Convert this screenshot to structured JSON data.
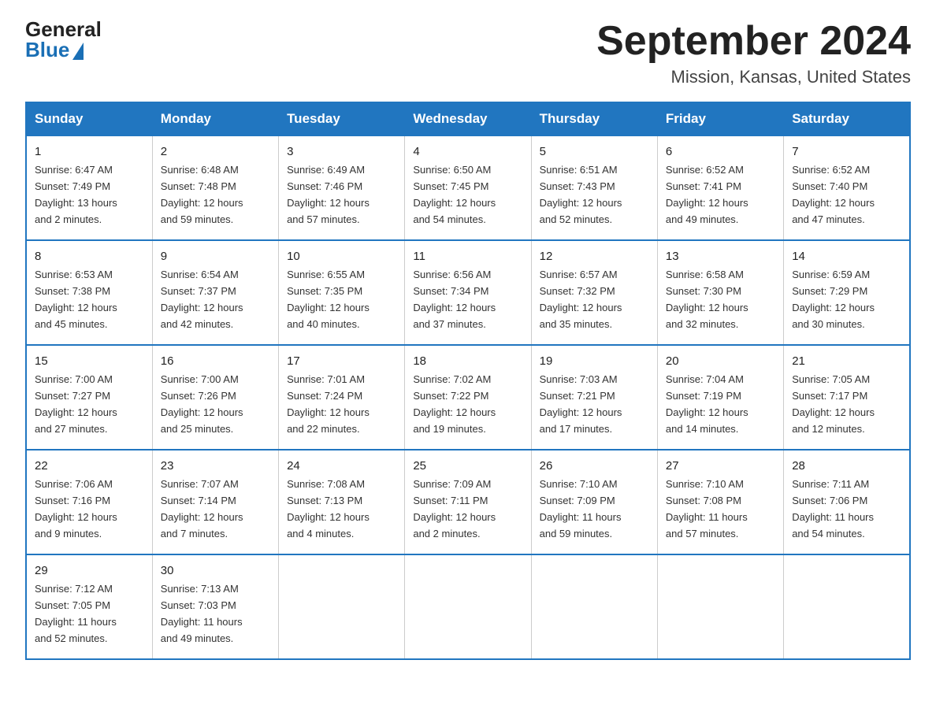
{
  "logo": {
    "general": "General",
    "blue": "Blue"
  },
  "title": "September 2024",
  "location": "Mission, Kansas, United States",
  "days_of_week": [
    "Sunday",
    "Monday",
    "Tuesday",
    "Wednesday",
    "Thursday",
    "Friday",
    "Saturday"
  ],
  "weeks": [
    [
      {
        "num": "1",
        "sunrise": "6:47 AM",
        "sunset": "7:49 PM",
        "daylight": "13 hours and 2 minutes."
      },
      {
        "num": "2",
        "sunrise": "6:48 AM",
        "sunset": "7:48 PM",
        "daylight": "12 hours and 59 minutes."
      },
      {
        "num": "3",
        "sunrise": "6:49 AM",
        "sunset": "7:46 PM",
        "daylight": "12 hours and 57 minutes."
      },
      {
        "num": "4",
        "sunrise": "6:50 AM",
        "sunset": "7:45 PM",
        "daylight": "12 hours and 54 minutes."
      },
      {
        "num": "5",
        "sunrise": "6:51 AM",
        "sunset": "7:43 PM",
        "daylight": "12 hours and 52 minutes."
      },
      {
        "num": "6",
        "sunrise": "6:52 AM",
        "sunset": "7:41 PM",
        "daylight": "12 hours and 49 minutes."
      },
      {
        "num": "7",
        "sunrise": "6:52 AM",
        "sunset": "7:40 PM",
        "daylight": "12 hours and 47 minutes."
      }
    ],
    [
      {
        "num": "8",
        "sunrise": "6:53 AM",
        "sunset": "7:38 PM",
        "daylight": "12 hours and 45 minutes."
      },
      {
        "num": "9",
        "sunrise": "6:54 AM",
        "sunset": "7:37 PM",
        "daylight": "12 hours and 42 minutes."
      },
      {
        "num": "10",
        "sunrise": "6:55 AM",
        "sunset": "7:35 PM",
        "daylight": "12 hours and 40 minutes."
      },
      {
        "num": "11",
        "sunrise": "6:56 AM",
        "sunset": "7:34 PM",
        "daylight": "12 hours and 37 minutes."
      },
      {
        "num": "12",
        "sunrise": "6:57 AM",
        "sunset": "7:32 PM",
        "daylight": "12 hours and 35 minutes."
      },
      {
        "num": "13",
        "sunrise": "6:58 AM",
        "sunset": "7:30 PM",
        "daylight": "12 hours and 32 minutes."
      },
      {
        "num": "14",
        "sunrise": "6:59 AM",
        "sunset": "7:29 PM",
        "daylight": "12 hours and 30 minutes."
      }
    ],
    [
      {
        "num": "15",
        "sunrise": "7:00 AM",
        "sunset": "7:27 PM",
        "daylight": "12 hours and 27 minutes."
      },
      {
        "num": "16",
        "sunrise": "7:00 AM",
        "sunset": "7:26 PM",
        "daylight": "12 hours and 25 minutes."
      },
      {
        "num": "17",
        "sunrise": "7:01 AM",
        "sunset": "7:24 PM",
        "daylight": "12 hours and 22 minutes."
      },
      {
        "num": "18",
        "sunrise": "7:02 AM",
        "sunset": "7:22 PM",
        "daylight": "12 hours and 19 minutes."
      },
      {
        "num": "19",
        "sunrise": "7:03 AM",
        "sunset": "7:21 PM",
        "daylight": "12 hours and 17 minutes."
      },
      {
        "num": "20",
        "sunrise": "7:04 AM",
        "sunset": "7:19 PM",
        "daylight": "12 hours and 14 minutes."
      },
      {
        "num": "21",
        "sunrise": "7:05 AM",
        "sunset": "7:17 PM",
        "daylight": "12 hours and 12 minutes."
      }
    ],
    [
      {
        "num": "22",
        "sunrise": "7:06 AM",
        "sunset": "7:16 PM",
        "daylight": "12 hours and 9 minutes."
      },
      {
        "num": "23",
        "sunrise": "7:07 AM",
        "sunset": "7:14 PM",
        "daylight": "12 hours and 7 minutes."
      },
      {
        "num": "24",
        "sunrise": "7:08 AM",
        "sunset": "7:13 PM",
        "daylight": "12 hours and 4 minutes."
      },
      {
        "num": "25",
        "sunrise": "7:09 AM",
        "sunset": "7:11 PM",
        "daylight": "12 hours and 2 minutes."
      },
      {
        "num": "26",
        "sunrise": "7:10 AM",
        "sunset": "7:09 PM",
        "daylight": "11 hours and 59 minutes."
      },
      {
        "num": "27",
        "sunrise": "7:10 AM",
        "sunset": "7:08 PM",
        "daylight": "11 hours and 57 minutes."
      },
      {
        "num": "28",
        "sunrise": "7:11 AM",
        "sunset": "7:06 PM",
        "daylight": "11 hours and 54 minutes."
      }
    ],
    [
      {
        "num": "29",
        "sunrise": "7:12 AM",
        "sunset": "7:05 PM",
        "daylight": "11 hours and 52 minutes."
      },
      {
        "num": "30",
        "sunrise": "7:13 AM",
        "sunset": "7:03 PM",
        "daylight": "11 hours and 49 minutes."
      },
      null,
      null,
      null,
      null,
      null
    ]
  ],
  "labels": {
    "sunrise": "Sunrise:",
    "sunset": "Sunset:",
    "daylight": "Daylight:"
  }
}
